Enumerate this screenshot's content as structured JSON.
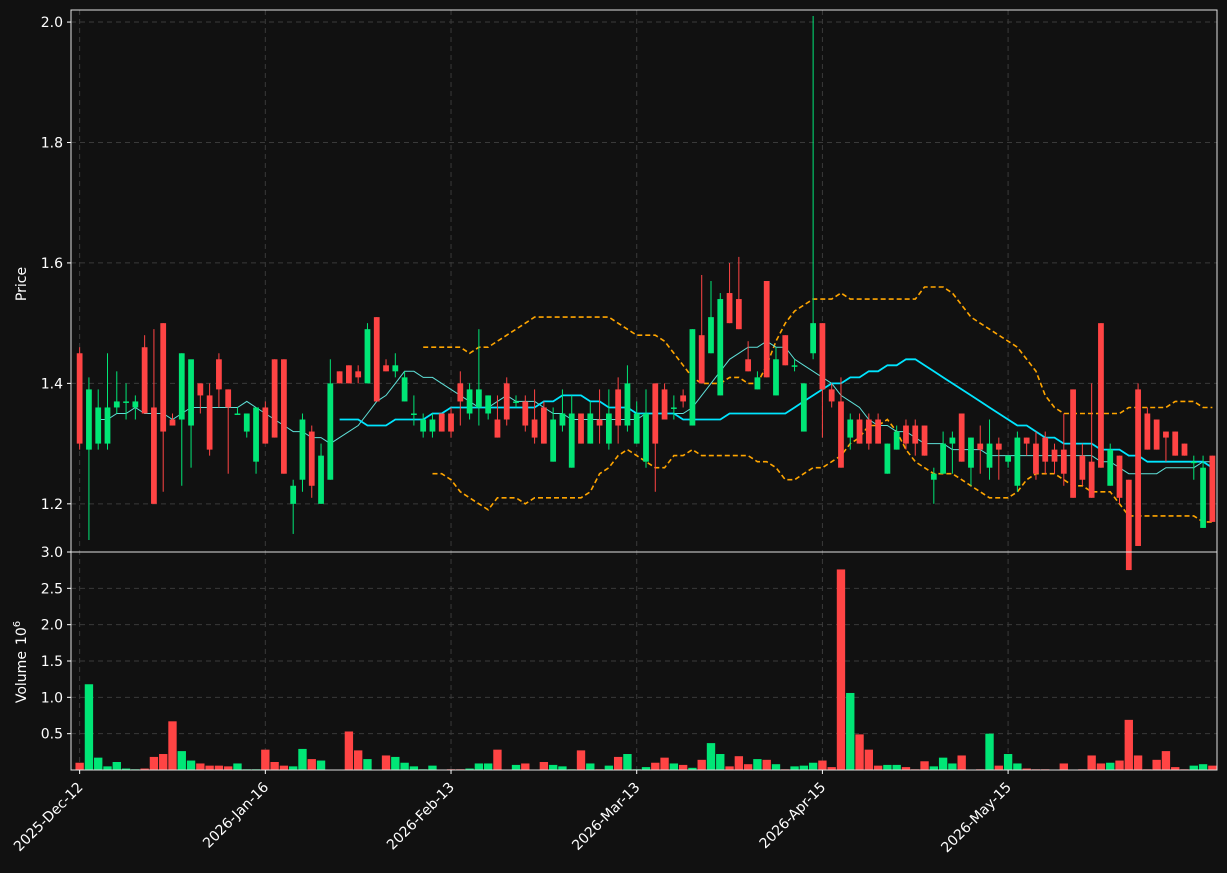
{
  "colors": {
    "background": "#111111",
    "up": "#00e676",
    "down": "#ff4444",
    "ma_fast": "#5fe0d8",
    "ma_slow": "#00e5ff",
    "band": "#ffa500",
    "grid": "#3a3a3a",
    "text": "#ffffff"
  },
  "chart_data": [
    {
      "type": "candlestick",
      "ylabel": "Price",
      "ylim": [
        1.12,
        2.02
      ],
      "yticks": [
        "1.2",
        "1.4",
        "1.6",
        "1.8",
        "2.0"
      ],
      "xticks": [
        "2025-Dec-12",
        "2026-Jan-16",
        "2026-Feb-13",
        "2026-Mar-13",
        "2026-Apr-15",
        "2026-May-15"
      ],
      "grid": true,
      "ohlc": [
        [
          1.45,
          1.46,
          1.29,
          1.3
        ],
        [
          1.29,
          1.41,
          1.14,
          1.39
        ],
        [
          1.3,
          1.39,
          1.29,
          1.36
        ],
        [
          1.3,
          1.45,
          1.29,
          1.36
        ],
        [
          1.36,
          1.42,
          1.35,
          1.37
        ],
        [
          1.37,
          1.4,
          1.34,
          1.37
        ],
        [
          1.36,
          1.38,
          1.34,
          1.37
        ],
        [
          1.46,
          1.48,
          1.35,
          1.35
        ],
        [
          1.36,
          1.49,
          1.2,
          1.2
        ],
        [
          1.5,
          1.5,
          1.22,
          1.32
        ],
        [
          1.34,
          1.35,
          1.33,
          1.33
        ],
        [
          1.34,
          1.45,
          1.23,
          1.45
        ],
        [
          1.33,
          1.43,
          1.26,
          1.44
        ],
        [
          1.4,
          1.4,
          1.35,
          1.38
        ],
        [
          1.38,
          1.4,
          1.28,
          1.29
        ],
        [
          1.44,
          1.45,
          1.36,
          1.39
        ],
        [
          1.39,
          1.39,
          1.25,
          1.36
        ],
        [
          1.35,
          1.36,
          1.35,
          1.35
        ],
        [
          1.32,
          1.34,
          1.31,
          1.35
        ],
        [
          1.27,
          1.36,
          1.25,
          1.36
        ],
        [
          1.36,
          1.37,
          1.3,
          1.3
        ],
        [
          1.44,
          1.44,
          1.31,
          1.31
        ],
        [
          1.44,
          1.44,
          1.25,
          1.25
        ],
        [
          1.2,
          1.24,
          1.15,
          1.23
        ],
        [
          1.24,
          1.35,
          1.22,
          1.34
        ],
        [
          1.32,
          1.33,
          1.21,
          1.23
        ],
        [
          1.2,
          1.3,
          1.2,
          1.28
        ],
        [
          1.24,
          1.44,
          1.24,
          1.4
        ],
        [
          1.42,
          1.42,
          1.4,
          1.4
        ],
        [
          1.43,
          1.43,
          1.4,
          1.4
        ],
        [
          1.42,
          1.43,
          1.4,
          1.41
        ],
        [
          1.4,
          1.5,
          1.4,
          1.49
        ],
        [
          1.51,
          1.51,
          1.37,
          1.37
        ],
        [
          1.43,
          1.44,
          1.42,
          1.42
        ],
        [
          1.42,
          1.45,
          1.41,
          1.43
        ],
        [
          1.37,
          1.42,
          1.37,
          1.41
        ],
        [
          1.35,
          1.38,
          1.33,
          1.35
        ],
        [
          1.32,
          1.35,
          1.31,
          1.34
        ],
        [
          1.32,
          1.35,
          1.31,
          1.34
        ],
        [
          1.35,
          1.35,
          1.32,
          1.32
        ],
        [
          1.35,
          1.36,
          1.31,
          1.32
        ],
        [
          1.4,
          1.42,
          1.33,
          1.37
        ],
        [
          1.35,
          1.4,
          1.34,
          1.39
        ],
        [
          1.36,
          1.49,
          1.33,
          1.39
        ],
        [
          1.35,
          1.38,
          1.34,
          1.38
        ],
        [
          1.34,
          1.38,
          1.31,
          1.31
        ],
        [
          1.4,
          1.41,
          1.33,
          1.34
        ],
        [
          1.37,
          1.38,
          1.36,
          1.37
        ],
        [
          1.37,
          1.38,
          1.32,
          1.33
        ],
        [
          1.34,
          1.39,
          1.3,
          1.31
        ],
        [
          1.36,
          1.37,
          1.3,
          1.3
        ],
        [
          1.27,
          1.36,
          1.27,
          1.34
        ],
        [
          1.33,
          1.39,
          1.32,
          1.35
        ],
        [
          1.26,
          1.38,
          1.26,
          1.35
        ],
        [
          1.35,
          1.35,
          1.3,
          1.3
        ],
        [
          1.3,
          1.37,
          1.3,
          1.35
        ],
        [
          1.34,
          1.39,
          1.3,
          1.33
        ],
        [
          1.3,
          1.39,
          1.29,
          1.35
        ],
        [
          1.39,
          1.41,
          1.3,
          1.33
        ],
        [
          1.33,
          1.43,
          1.32,
          1.4
        ],
        [
          1.3,
          1.37,
          1.3,
          1.35
        ],
        [
          1.27,
          1.39,
          1.26,
          1.35
        ],
        [
          1.4,
          1.4,
          1.22,
          1.3
        ],
        [
          1.39,
          1.4,
          1.34,
          1.34
        ],
        [
          1.36,
          1.38,
          1.34,
          1.36
        ],
        [
          1.38,
          1.39,
          1.36,
          1.37
        ],
        [
          1.33,
          1.49,
          1.33,
          1.49
        ],
        [
          1.48,
          1.58,
          1.4,
          1.4
        ],
        [
          1.45,
          1.57,
          1.45,
          1.51
        ],
        [
          1.38,
          1.55,
          1.38,
          1.54
        ],
        [
          1.55,
          1.6,
          1.5,
          1.5
        ],
        [
          1.54,
          1.61,
          1.49,
          1.49
        ],
        [
          1.44,
          1.47,
          1.42,
          1.42
        ],
        [
          1.39,
          1.42,
          1.39,
          1.41
        ],
        [
          1.57,
          1.57,
          1.41,
          1.41
        ],
        [
          1.38,
          1.46,
          1.38,
          1.44
        ],
        [
          1.48,
          1.48,
          1.43,
          1.43
        ],
        [
          1.43,
          1.44,
          1.42,
          1.43
        ],
        [
          1.32,
          1.4,
          1.32,
          1.4
        ],
        [
          1.45,
          2.01,
          1.44,
          1.5
        ],
        [
          1.5,
          1.5,
          1.31,
          1.39
        ],
        [
          1.39,
          1.4,
          1.36,
          1.37
        ],
        [
          1.37,
          1.41,
          1.26,
          1.26
        ],
        [
          1.31,
          1.35,
          1.29,
          1.34
        ],
        [
          1.34,
          1.35,
          1.3,
          1.3
        ],
        [
          1.34,
          1.35,
          1.29,
          1.3
        ],
        [
          1.34,
          1.35,
          1.3,
          1.3
        ],
        [
          1.25,
          1.3,
          1.25,
          1.3
        ],
        [
          1.29,
          1.33,
          1.29,
          1.32
        ],
        [
          1.33,
          1.34,
          1.29,
          1.3
        ],
        [
          1.33,
          1.34,
          1.28,
          1.3
        ],
        [
          1.33,
          1.33,
          1.28,
          1.28
        ],
        [
          1.24,
          1.26,
          1.2,
          1.25
        ],
        [
          1.25,
          1.32,
          1.25,
          1.3
        ],
        [
          1.3,
          1.32,
          1.25,
          1.31
        ],
        [
          1.35,
          1.35,
          1.27,
          1.27
        ],
        [
          1.26,
          1.31,
          1.23,
          1.31
        ],
        [
          1.3,
          1.33,
          1.25,
          1.29
        ],
        [
          1.26,
          1.34,
          1.24,
          1.3
        ],
        [
          1.3,
          1.31,
          1.24,
          1.29
        ],
        [
          1.27,
          1.28,
          1.26,
          1.28
        ],
        [
          1.23,
          1.32,
          1.22,
          1.31
        ],
        [
          1.31,
          1.31,
          1.28,
          1.3
        ],
        [
          1.3,
          1.32,
          1.24,
          1.25
        ],
        [
          1.31,
          1.32,
          1.25,
          1.27
        ],
        [
          1.29,
          1.3,
          1.25,
          1.27
        ],
        [
          1.29,
          1.35,
          1.23,
          1.25
        ],
        [
          1.39,
          1.39,
          1.21,
          1.21
        ],
        [
          1.28,
          1.3,
          1.23,
          1.24
        ],
        [
          1.27,
          1.4,
          1.21,
          1.21
        ],
        [
          1.5,
          1.5,
          1.26,
          1.26
        ],
        [
          1.23,
          1.3,
          1.23,
          1.29
        ],
        [
          1.28,
          1.28,
          1.2,
          1.21
        ],
        [
          1.24,
          1.24,
          1.09,
          1.09
        ],
        [
          1.39,
          1.4,
          1.13,
          1.13
        ],
        [
          1.35,
          1.36,
          1.29,
          1.29
        ],
        [
          1.34,
          1.34,
          1.29,
          1.29
        ],
        [
          1.32,
          1.32,
          1.27,
          1.31
        ],
        [
          1.32,
          1.32,
          1.28,
          1.28
        ],
        [
          1.3,
          1.3,
          1.28,
          1.28
        ],
        [
          1.27,
          1.28,
          1.24,
          1.27
        ],
        [
          1.16,
          1.28,
          1.16,
          1.26
        ],
        [
          1.28,
          1.28,
          1.17,
          1.17
        ]
      ],
      "ma_fast": [
        1.34,
        1.34,
        1.35,
        1.35,
        1.36,
        1.35,
        1.35,
        1.35,
        1.34,
        1.35,
        1.36,
        1.36,
        1.36,
        1.36,
        1.36,
        1.36,
        1.37,
        1.36,
        1.35,
        1.34,
        1.33,
        1.32,
        1.32,
        1.31,
        1.31,
        1.3,
        1.31,
        1.32,
        1.33,
        1.35,
        1.37,
        1.38,
        1.4,
        1.42,
        1.42,
        1.41,
        1.41,
        1.4,
        1.39,
        1.38,
        1.37,
        1.36,
        1.36,
        1.37,
        1.38,
        1.37,
        1.37,
        1.37,
        1.36,
        1.35,
        1.35,
        1.34,
        1.34,
        1.34,
        1.34,
        1.34,
        1.34,
        1.34,
        1.34,
        1.35,
        1.35,
        1.35,
        1.35,
        1.35,
        1.36,
        1.38,
        1.4,
        1.42,
        1.44,
        1.45,
        1.46,
        1.46,
        1.47,
        1.46,
        1.46,
        1.44,
        1.43,
        1.42,
        1.41,
        1.4,
        1.38,
        1.37,
        1.36,
        1.34,
        1.33,
        1.33,
        1.32,
        1.32,
        1.31,
        1.3,
        1.3,
        1.3,
        1.29,
        1.29,
        1.29,
        1.29,
        1.28,
        1.28,
        1.28,
        1.28,
        1.28,
        1.28,
        1.28,
        1.28,
        1.28,
        1.28,
        1.28,
        1.28,
        1.27,
        1.27,
        1.26,
        1.25,
        1.25,
        1.25,
        1.25,
        1.26,
        1.26,
        1.26,
        1.26,
        1.27,
        1.27
      ],
      "ma_slow": [
        1.34,
        1.34,
        1.34,
        1.33,
        1.33,
        1.33,
        1.34,
        1.34,
        1.34,
        1.34,
        1.35,
        1.35,
        1.36,
        1.36,
        1.36,
        1.36,
        1.36,
        1.36,
        1.36,
        1.36,
        1.36,
        1.36,
        1.37,
        1.37,
        1.38,
        1.38,
        1.38,
        1.37,
        1.37,
        1.36,
        1.36,
        1.36,
        1.35,
        1.35,
        1.35,
        1.35,
        1.35,
        1.34,
        1.34,
        1.34,
        1.34,
        1.34,
        1.35,
        1.35,
        1.35,
        1.35,
        1.35,
        1.35,
        1.35,
        1.36,
        1.37,
        1.38,
        1.39,
        1.4,
        1.4,
        1.41,
        1.41,
        1.42,
        1.42,
        1.43,
        1.43,
        1.44,
        1.44,
        1.43,
        1.42,
        1.41,
        1.4,
        1.39,
        1.38,
        1.37,
        1.36,
        1.35,
        1.34,
        1.33,
        1.33,
        1.32,
        1.31,
        1.31,
        1.3,
        1.3,
        1.3,
        1.3,
        1.29,
        1.29,
        1.29,
        1.28,
        1.28,
        1.27,
        1.27,
        1.27,
        1.27,
        1.27,
        1.27,
        1.27,
        1.26
      ],
      "band_upper": [
        1.46,
        1.46,
        1.46,
        1.46,
        1.46,
        1.45,
        1.46,
        1.46,
        1.47,
        1.48,
        1.49,
        1.5,
        1.51,
        1.51,
        1.51,
        1.51,
        1.51,
        1.51,
        1.51,
        1.51,
        1.51,
        1.5,
        1.49,
        1.48,
        1.48,
        1.48,
        1.47,
        1.45,
        1.43,
        1.41,
        1.4,
        1.4,
        1.4,
        1.41,
        1.41,
        1.4,
        1.4,
        1.43,
        1.47,
        1.5,
        1.52,
        1.53,
        1.54,
        1.54,
        1.54,
        1.55,
        1.54,
        1.54,
        1.54,
        1.54,
        1.54,
        1.54,
        1.54,
        1.54,
        1.56,
        1.56,
        1.56,
        1.55,
        1.53,
        1.51,
        1.5,
        1.49,
        1.48,
        1.47,
        1.46,
        1.44,
        1.42,
        1.38,
        1.36,
        1.35,
        1.35,
        1.35,
        1.35,
        1.35,
        1.35,
        1.35,
        1.36,
        1.36,
        1.36,
        1.36,
        1.36,
        1.37,
        1.37,
        1.37,
        1.36,
        1.36
      ],
      "band_lower": [
        1.25,
        1.25,
        1.24,
        1.22,
        1.21,
        1.2,
        1.19,
        1.21,
        1.21,
        1.21,
        1.2,
        1.21,
        1.21,
        1.21,
        1.21,
        1.21,
        1.21,
        1.22,
        1.25,
        1.26,
        1.28,
        1.29,
        1.28,
        1.27,
        1.26,
        1.26,
        1.28,
        1.28,
        1.29,
        1.28,
        1.28,
        1.28,
        1.28,
        1.28,
        1.28,
        1.27,
        1.27,
        1.26,
        1.24,
        1.24,
        1.25,
        1.26,
        1.26,
        1.27,
        1.28,
        1.3,
        1.31,
        1.33,
        1.33,
        1.34,
        1.32,
        1.29,
        1.27,
        1.26,
        1.25,
        1.25,
        1.25,
        1.24,
        1.23,
        1.22,
        1.21,
        1.21,
        1.21,
        1.22,
        1.24,
        1.25,
        1.25,
        1.25,
        1.24,
        1.23,
        1.23,
        1.22,
        1.22,
        1.22,
        1.2,
        1.18,
        1.18,
        1.18,
        1.18,
        1.18,
        1.18,
        1.18,
        1.18,
        1.17,
        1.17
      ]
    },
    {
      "type": "bar",
      "ylabel": "Volume",
      "unit_exponent": "6",
      "ylim": [
        0,
        3.0
      ],
      "yticks": [
        "0.5",
        "1.0",
        "1.5",
        "2.0",
        "2.5",
        "3.0"
      ],
      "grid": true,
      "values": [
        0.1,
        1.18,
        0.17,
        0.05,
        0.11,
        0.02,
        0.01,
        0.02,
        0.18,
        0.22,
        0.67,
        0.26,
        0.13,
        0.09,
        0.06,
        0.06,
        0.05,
        0.09,
        0.01,
        0.01,
        0.28,
        0.11,
        0.06,
        0.05,
        0.29,
        0.15,
        0.13,
        0.0,
        0.0,
        0.53,
        0.27,
        0.15,
        0.0,
        0.2,
        0.18,
        0.1,
        0.05,
        0.01,
        0.06,
        0.0,
        0.01,
        0.01,
        0.02,
        0.09,
        0.09,
        0.28,
        0.0,
        0.07,
        0.09,
        0.0,
        0.11,
        0.07,
        0.05,
        0.01,
        0.27,
        0.09,
        0.01,
        0.06,
        0.18,
        0.22,
        0.01,
        0.04,
        0.1,
        0.17,
        0.09,
        0.07,
        0.03,
        0.14,
        0.37,
        0.22,
        0.05,
        0.19,
        0.08,
        0.15,
        0.14,
        0.08,
        0.01,
        0.05,
        0.06,
        0.1,
        0.13,
        0.04,
        2.76,
        1.06,
        0.49,
        0.28,
        0.06,
        0.07,
        0.07,
        0.04,
        0.01,
        0.12,
        0.05,
        0.17,
        0.09,
        0.2,
        0.0,
        0.01,
        0.5,
        0.06,
        0.22,
        0.09,
        0.02,
        0.01,
        0.01,
        0.0,
        0.09,
        0.0,
        0.01,
        0.2,
        0.09,
        0.1,
        0.13,
        0.69,
        0.2,
        0.01,
        0.14,
        0.26,
        0.04,
        0.01,
        0.06,
        0.08,
        0.06,
        0.01,
        0.05,
        0.06
      ]
    }
  ]
}
